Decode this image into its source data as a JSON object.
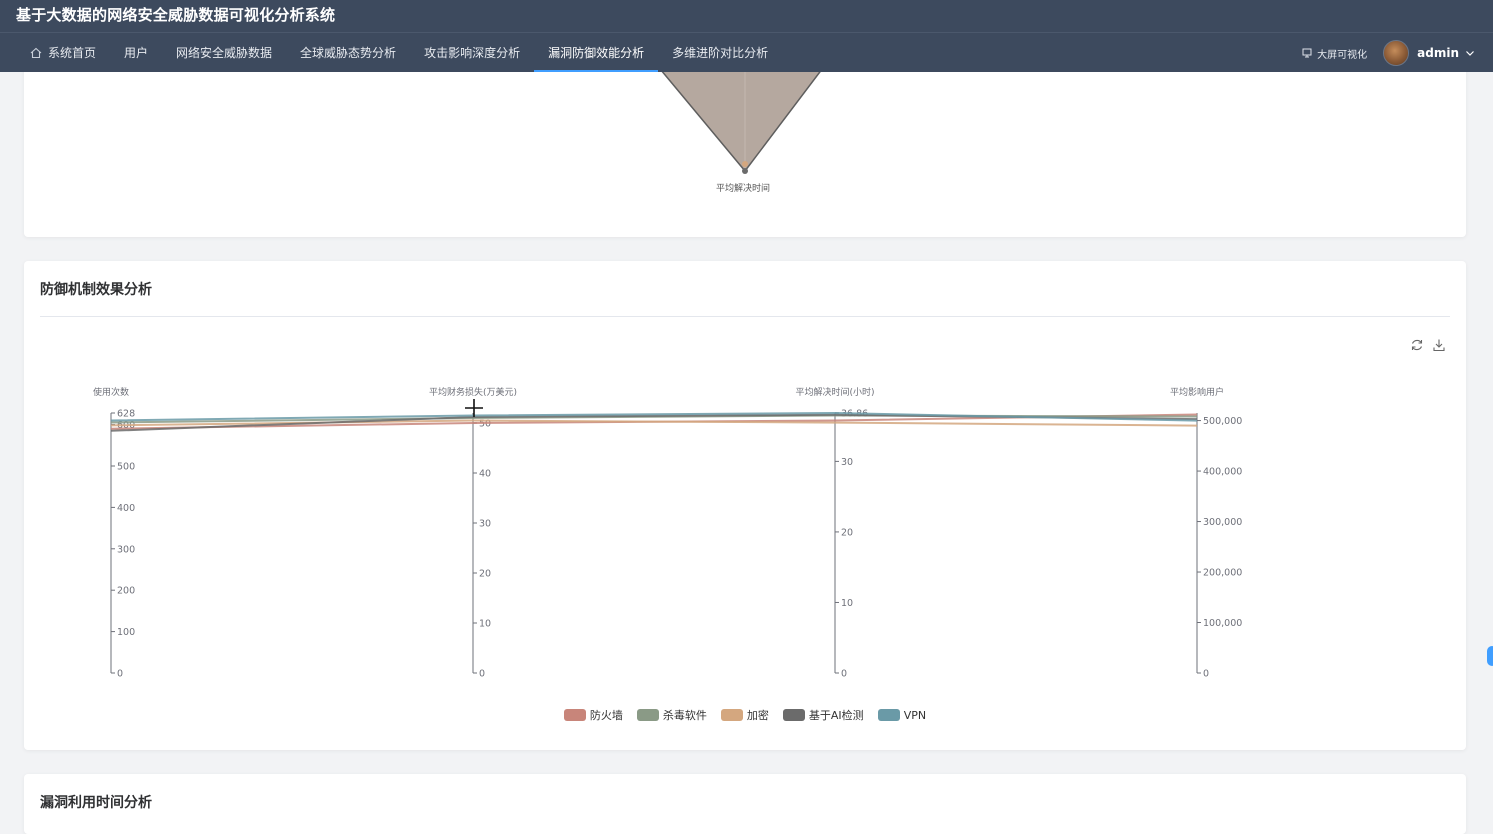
{
  "app": {
    "title": "基于大数据的网络安全威胁数据可视化分析系统"
  },
  "nav": {
    "items": [
      {
        "label": "系统首页",
        "icon": "home-icon"
      },
      {
        "label": "用户"
      },
      {
        "label": "网络安全威胁数据"
      },
      {
        "label": "全球威胁态势分析"
      },
      {
        "label": "攻击影响深度分析"
      },
      {
        "label": "漏洞防御效能分析",
        "active": true
      },
      {
        "label": "多维进阶对比分析"
      }
    ],
    "bigscreen_label": "大屏可视化",
    "username": "admin"
  },
  "radar_card": {
    "axis_label": "平均解决时间"
  },
  "defense_card": {
    "title": "防御机制效果分析"
  },
  "next_card": {
    "title": "漏洞利用时间分析"
  },
  "chart_data": {
    "type": "parallel",
    "dimensions": [
      {
        "name": "使用次数",
        "min": 0,
        "max": 628,
        "ticks": [
          "0",
          "100",
          "200",
          "300",
          "400",
          "500",
          "600",
          "628"
        ]
      },
      {
        "name": "平均财务损失(万美元)",
        "min": 0,
        "max": 52,
        "ticks": [
          "0",
          "10",
          "20",
          "30",
          "40",
          "50"
        ]
      },
      {
        "name": "平均解决时间(小时)",
        "min": 0,
        "max": 36.86,
        "ticks": [
          "0",
          "10",
          "20",
          "30",
          "36.86"
        ]
      },
      {
        "name": "平均影响用户",
        "min": 0,
        "max": 515000,
        "ticks": [
          "0",
          "100,000",
          "200,000",
          "300,000",
          "400,000",
          "500,000"
        ]
      }
    ],
    "series": [
      {
        "name": "防火墙",
        "color": "#c8857a",
        "values": [
          590,
          50.0,
          35.8,
          512000
        ]
      },
      {
        "name": "杀毒软件",
        "color": "#8a9a86",
        "values": [
          605,
          51.0,
          36.5,
          508000
        ]
      },
      {
        "name": "加密",
        "color": "#d4a77f",
        "values": [
          598,
          50.5,
          35.5,
          490000
        ]
      },
      {
        "name": "基于AI检测",
        "color": "#6b6b6b",
        "values": [
          585,
          51.2,
          36.6,
          503000
        ]
      },
      {
        "name": "VPN",
        "color": "#6a9aa7",
        "values": [
          610,
          51.5,
          36.86,
          500000
        ]
      }
    ]
  }
}
